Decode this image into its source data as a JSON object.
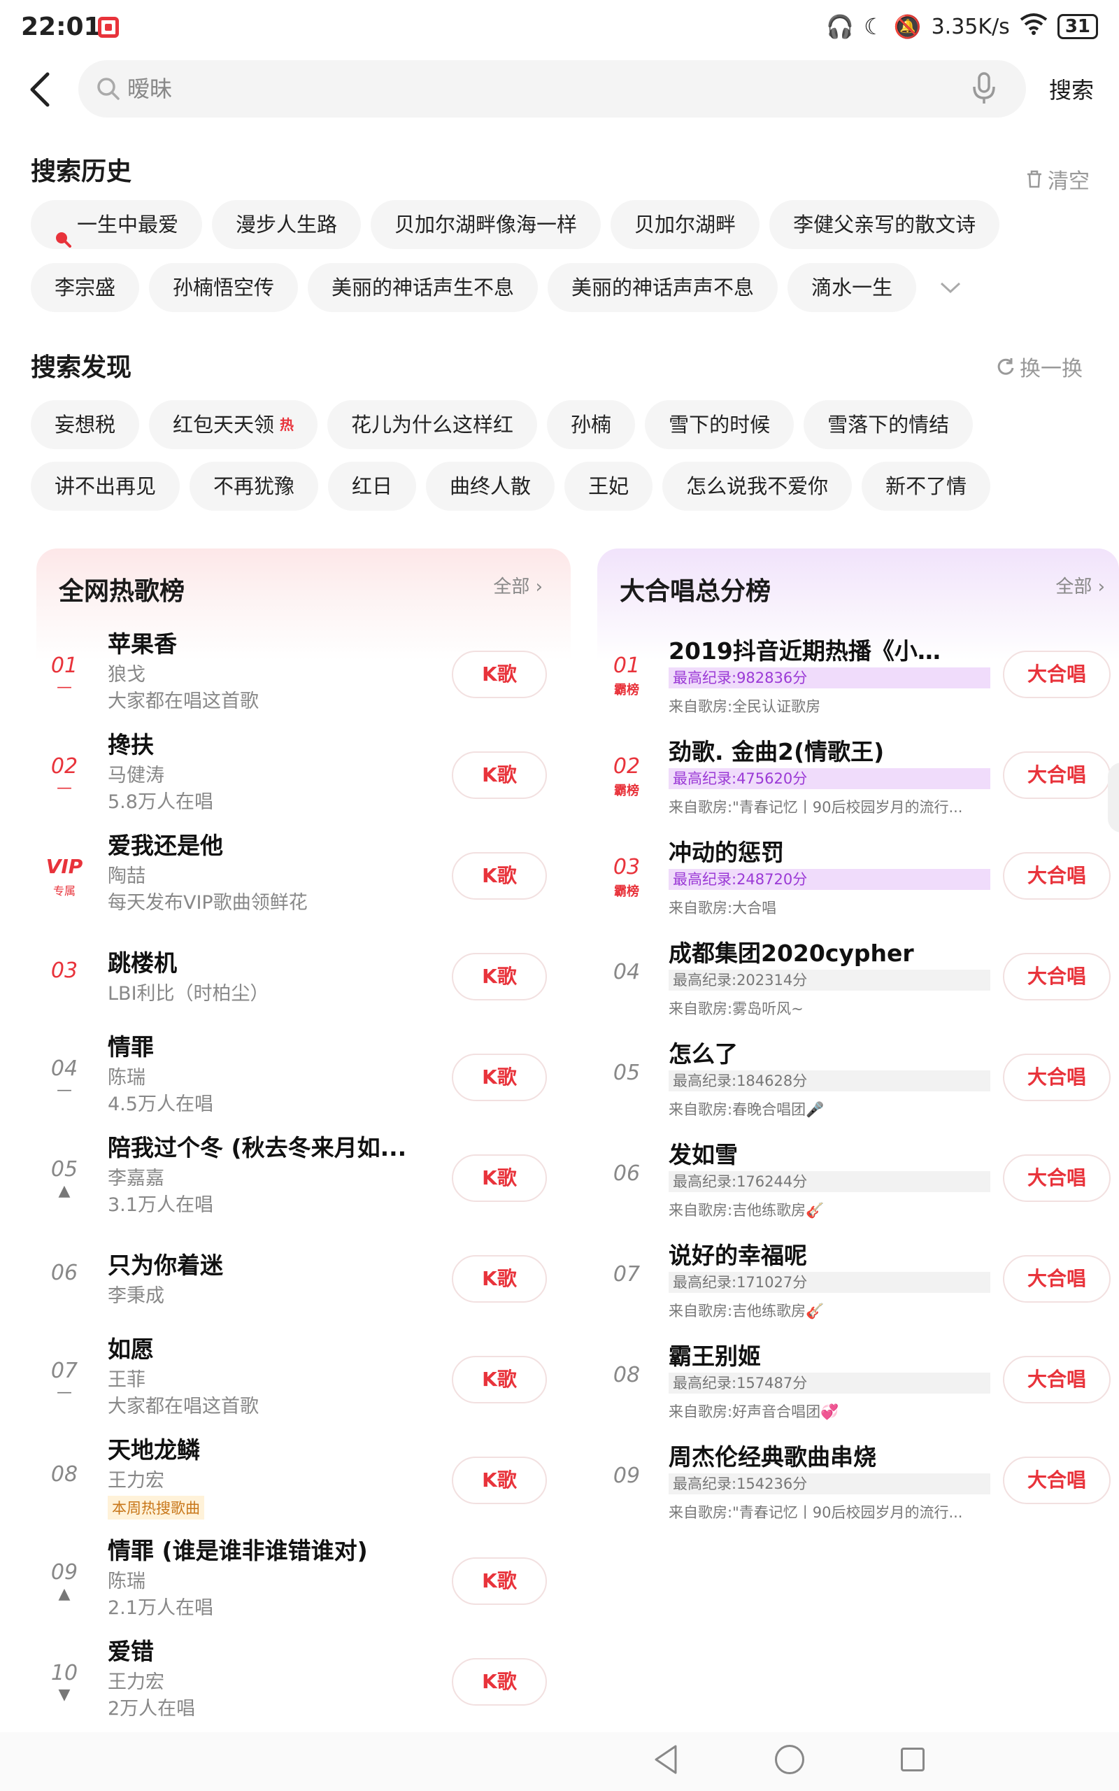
{
  "status": {
    "time": "22:01",
    "speed": "3.35K/s",
    "battery": "31"
  },
  "search": {
    "placeholder": "暧昧",
    "button": "搜索"
  },
  "history": {
    "title": "搜索历史",
    "clear": "清空",
    "row1": [
      "一生中最爱",
      "漫步人生路",
      "贝加尔湖畔像海一样",
      "贝加尔湖畔",
      "李健父亲写的散文诗"
    ],
    "row2": [
      "李宗盛",
      "孙楠悟空传",
      "美丽的神话声生不息",
      "美丽的神话声声不息",
      "滴水一生"
    ]
  },
  "discover": {
    "title": "搜索发现",
    "refresh": "换一换",
    "row1": [
      "妄想税",
      "红包天天领",
      "花儿为什么这样红",
      "孙楠",
      "雪下的时候",
      "雪落下的情结"
    ],
    "row2": [
      "讲不出再见",
      "不再犹豫",
      "红日",
      "曲终人散",
      "王妃",
      "怎么说我不爱你",
      "新不了情"
    ],
    "hot_tag": "热"
  },
  "hot_chart": {
    "title": "全网热歌榜",
    "all": "全部 ›",
    "k_label": "K歌",
    "vip_label": "VIP",
    "vip_sub": "专属",
    "items": [
      {
        "rank": "01",
        "trend": "—",
        "song": "苹果香",
        "artist": "狼戈",
        "info": "大家都在唱这首歌"
      },
      {
        "rank": "02",
        "trend": "—",
        "song": "搀扶",
        "artist": "马健涛",
        "info": "5.8万人在唱"
      },
      {
        "rank": "",
        "trend": "",
        "song": "爱我还是他",
        "artist": "陶喆",
        "info": "每天发布VIP歌曲领鲜花"
      },
      {
        "rank": "03",
        "trend": "",
        "song": "跳楼机",
        "artist": "LBI利比（时柏尘）",
        "info": ""
      },
      {
        "rank": "04",
        "trend": "—",
        "song": "情罪",
        "artist": "陈瑞",
        "info": "4.5万人在唱"
      },
      {
        "rank": "05",
        "trend": "▲",
        "song": "陪我过个冬 (秋去冬来月如...",
        "artist": "李嘉嘉",
        "info": "3.1万人在唱"
      },
      {
        "rank": "06",
        "trend": "",
        "song": "只为你着迷",
        "artist": "李秉成",
        "info": ""
      },
      {
        "rank": "07",
        "trend": "—",
        "song": "如愿",
        "artist": "王菲",
        "info": "大家都在唱这首歌"
      },
      {
        "rank": "08",
        "trend": "",
        "song": "天地龙鳞",
        "artist": "王力宏",
        "badge": "本周热搜歌曲"
      },
      {
        "rank": "09",
        "trend": "▲",
        "song": "情罪 (谁是谁非谁错谁对)",
        "artist": "陈瑞",
        "info": "2.1万人在唱"
      },
      {
        "rank": "10",
        "trend": "▼",
        "song": "爱错",
        "artist": "王力宏",
        "info": "2万人在唱"
      }
    ]
  },
  "chorus_chart": {
    "title": "大合唱总分榜",
    "all": "全部 ›",
    "btn_label": "大合唱",
    "top_sub": "霸榜",
    "items": [
      {
        "rank": "01",
        "song": "2019抖音近期热播《小阿...",
        "score": "最高纪录:982836分",
        "room": "来自歌房:全民认证歌房"
      },
      {
        "rank": "02",
        "song": "劲歌. 金曲2(情歌王)",
        "score": "最高纪录:475620分",
        "room": "来自歌房:\"青春记忆丨90后校园岁月的流行..."
      },
      {
        "rank": "03",
        "song": "冲动的惩罚",
        "score": "最高纪录:248720分",
        "room": "来自歌房:大合唱"
      },
      {
        "rank": "04",
        "song": "成都集团2020cypher",
        "score": "最高纪录:202314分",
        "room": "来自歌房:雾岛听风~"
      },
      {
        "rank": "05",
        "song": "怎么了",
        "score": "最高纪录:184628分",
        "room": "来自歌房:春晚合唱团🎤"
      },
      {
        "rank": "06",
        "song": "发如雪",
        "score": "最高纪录:176244分",
        "room": "来自歌房:吉他练歌房🎸"
      },
      {
        "rank": "07",
        "song": "说好的幸福呢",
        "score": "最高纪录:171027分",
        "room": "来自歌房:吉他练歌房🎸"
      },
      {
        "rank": "08",
        "song": "霸王别姬",
        "score": "最高纪录:157487分",
        "room": "来自歌房:好声音合唱团💞"
      },
      {
        "rank": "09",
        "song": "周杰伦经典歌曲串烧",
        "score": "最高纪录:154236分",
        "room": "来自歌房:\"青春记忆丨90后校园岁月的流行..."
      }
    ]
  },
  "colors": {
    "accent": "#e8333b",
    "purple": "#9b3ad6",
    "chip_bg": "#f5f5f5"
  }
}
